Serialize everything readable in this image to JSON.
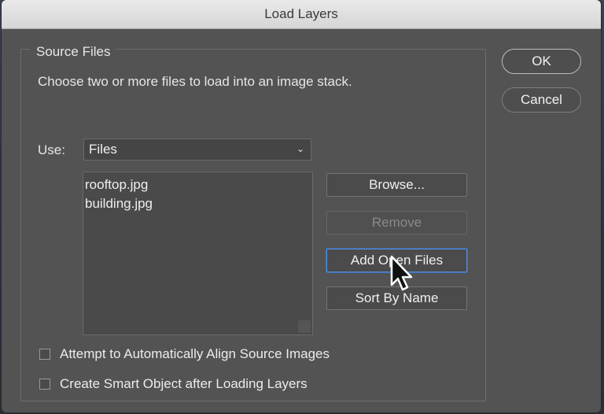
{
  "window": {
    "title": "Load Layers"
  },
  "source_files": {
    "legend": "Source Files",
    "description": "Choose two or more files to load into an image stack.",
    "use_label": "Use:",
    "use_value": "Files",
    "files": [
      "rooftop.jpg",
      "building.jpg"
    ]
  },
  "buttons": {
    "browse": "Browse...",
    "remove": "Remove",
    "add_open_files": "Add Open Files",
    "sort_by_name": "Sort By Name",
    "ok": "OK",
    "cancel": "Cancel"
  },
  "options": {
    "align_label": "Attempt to Automatically Align Source Images",
    "align_checked": false,
    "smart_object_label": "Create Smart Object after Loading Layers",
    "smart_object_checked": false
  },
  "icons": {
    "dropdown": "chevron-down-icon",
    "pointer": "mouse-pointer-icon"
  },
  "colors": {
    "panel": "#535353",
    "focus": "#5a8fd6"
  }
}
